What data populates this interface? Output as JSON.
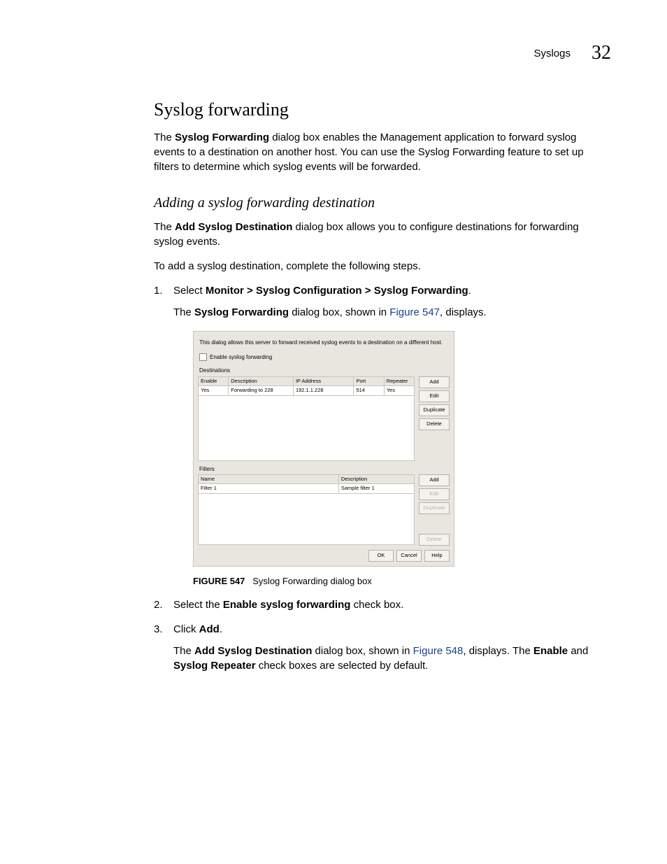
{
  "header": {
    "section_label": "Syslogs",
    "page_number": "32"
  },
  "title": "Syslog forwarding",
  "intro_prefix": "The ",
  "intro_bold": "Syslog Forwarding",
  "intro_suffix": " dialog box enables the Management application to forward syslog events to a destination on another host. You can use the Syslog Forwarding feature to set up filters to determine which syslog events will be forwarded.",
  "subheading": "Adding a syslog forwarding destination",
  "sub_intro_prefix": "The ",
  "sub_intro_bold": "Add Syslog Destination",
  "sub_intro_suffix": " dialog box allows you to configure destinations for forwarding syslog events.",
  "sub_instruction": "To add a syslog destination, complete the following steps.",
  "step1": {
    "prefix": "Select ",
    "bold": "Monitor > Syslog Configuration > Syslog Forwarding",
    "suffix": ".",
    "desc_prefix": "The ",
    "desc_bold": "Syslog Forwarding",
    "desc_mid": " dialog box, shown in ",
    "desc_link": "Figure 547",
    "desc_suffix": ", displays."
  },
  "dialog": {
    "intro": "This dialog allows this server to forward received syslog events to a destination on a different host.",
    "enable_label": "Enable syslog forwarding",
    "destinations_label": "Destinations",
    "dest_headers": [
      "Enable",
      "Description",
      "IP Address",
      "Port",
      "Repeater"
    ],
    "dest_row": [
      "Yes",
      "Forwarding to 228",
      "192.1.1.228",
      "514",
      "Yes"
    ],
    "dest_buttons": [
      "Add",
      "Edit",
      "Duplicate",
      "Delete"
    ],
    "filters_label": "Filters",
    "filter_headers": [
      "Name",
      "Description"
    ],
    "filter_row": [
      "Filter 1",
      "Sample filter 1"
    ],
    "filter_buttons_enabled": [
      "Add"
    ],
    "filter_buttons_disabled": [
      "Edit",
      "Duplicate"
    ],
    "filter_buttons_disabled_gap": [
      "Delete"
    ],
    "footer_buttons": [
      "OK",
      "Cancel",
      "Help"
    ]
  },
  "figure_caption_label": "FIGURE 547",
  "figure_caption_text": "Syslog Forwarding dialog box",
  "step2": {
    "prefix": "Select the ",
    "bold": "Enable syslog forwarding",
    "suffix": " check box."
  },
  "step3": {
    "prefix": "Click ",
    "bold": "Add",
    "suffix": ".",
    "desc_prefix": "The ",
    "desc_bold1": "Add Syslog Destination",
    "desc_mid1": " dialog box, shown in ",
    "desc_link": "Figure 548",
    "desc_mid2": ", displays. The ",
    "desc_bold2": "Enable",
    "desc_mid3": " and ",
    "desc_bold3": "Syslog Repeater",
    "desc_suffix": " check boxes are selected by default."
  }
}
